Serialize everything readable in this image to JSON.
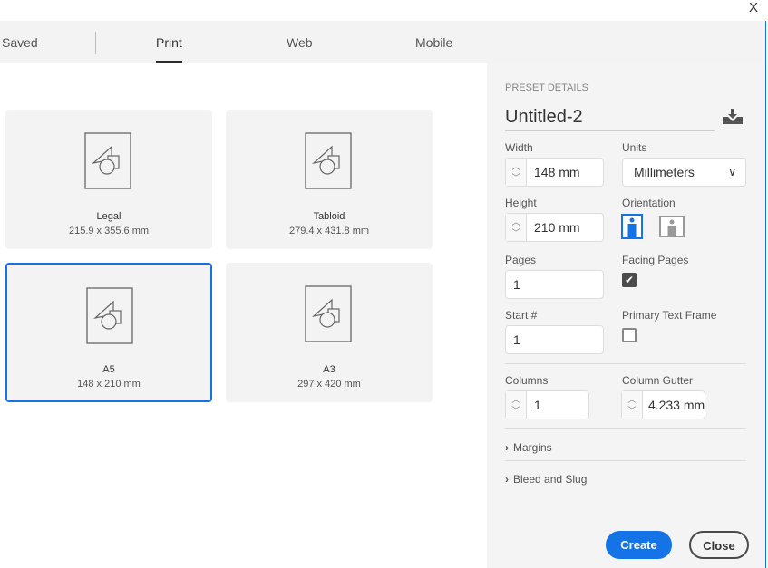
{
  "window": {
    "close": "X"
  },
  "tabs": [
    {
      "label": "Saved"
    },
    {
      "label": "Print",
      "active": true
    },
    {
      "label": "Web"
    },
    {
      "label": "Mobile"
    }
  ],
  "presets": [
    {
      "name": "Legal",
      "size": "215.9 x 355.6 mm"
    },
    {
      "name": "Tabloid",
      "size": "279.4 x 431.8 mm"
    },
    {
      "name": "A5",
      "size": "148 x 210 mm",
      "selected": true
    },
    {
      "name": "A3",
      "size": "297 x 420 mm"
    }
  ],
  "details": {
    "heading": "PRESET DETAILS",
    "name": "Untitled-2",
    "save_icon": "save-preset-icon",
    "width_label": "Width",
    "width": "148 mm",
    "units_label": "Units",
    "units": "Millimeters",
    "height_label": "Height",
    "height": "210 mm",
    "orientation_label": "Orientation",
    "orientation": "portrait",
    "pages_label": "Pages",
    "pages": "1",
    "facing_label": "Facing Pages",
    "facing": true,
    "start_label": "Start #",
    "start": "1",
    "ptf_label": "Primary Text Frame",
    "ptf": false,
    "columns_label": "Columns",
    "columns": "1",
    "gutter_label": "Column Gutter",
    "gutter": "4.233 mm",
    "margins": "Margins",
    "bleed": "Bleed and Slug"
  },
  "buttons": {
    "create": "Create",
    "close": "Close"
  },
  "colors": {
    "accent": "#1473e6"
  }
}
